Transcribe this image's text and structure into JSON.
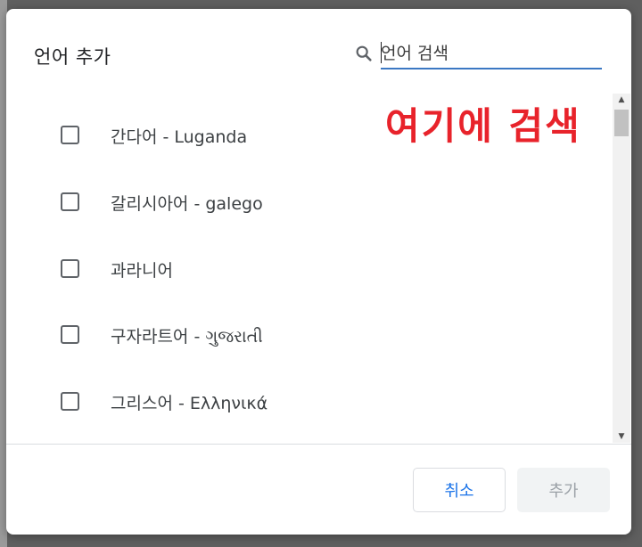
{
  "dialog": {
    "title": "언어 추가",
    "search": {
      "placeholder": "언어 검색",
      "value": ""
    },
    "annotation_text": "여기에 검색",
    "languages": [
      {
        "label": "간다어 - Luganda",
        "checked": false
      },
      {
        "label": "갈리시아어 - galego",
        "checked": false
      },
      {
        "label": "과라니어",
        "checked": false
      },
      {
        "label": "구자라트어 - ગુજરાતી",
        "checked": false
      },
      {
        "label": "그리스어 - Ελληνικά",
        "checked": false
      }
    ],
    "buttons": {
      "cancel": "취소",
      "add": "추가"
    }
  },
  "colors": {
    "accent": "#1a73e8",
    "search_underline": "#3b78c3",
    "annotation": "#e8232b",
    "disabled_text": "#9aa0a6"
  }
}
